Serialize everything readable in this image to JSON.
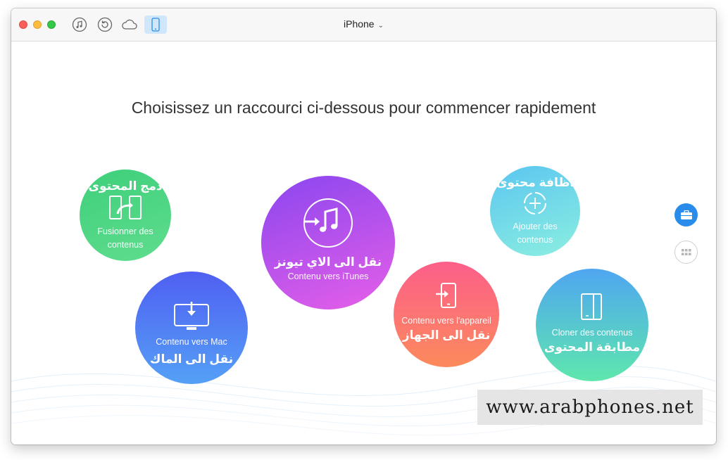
{
  "window": {
    "device_title": "iPhone",
    "toolbar_icons": [
      "music-note-icon",
      "restore-icon",
      "cloud-icon",
      "phone-icon"
    ]
  },
  "main": {
    "headline": "Choisissez un raccourci ci-dessous pour commencer rapidement"
  },
  "shortcuts": {
    "merge": {
      "ar": "دمج المحتوى",
      "fr": "Fusionner des contenus",
      "icon": "merge-devices-icon"
    },
    "mac": {
      "fr": "Contenu vers Mac",
      "ar": "نقل الى الماك",
      "icon": "monitor-download-icon"
    },
    "itunes": {
      "ar": "نقل الى الاي تيونز",
      "fr": "Contenu vers iTunes",
      "icon": "itunes-icon"
    },
    "device": {
      "fr": "Contenu vers l'appareil",
      "ar": "نقل الى الجهاز",
      "icon": "phone-import-icon"
    },
    "add": {
      "ar": "اظافة محتوى",
      "fr": "Ajouter des contenus",
      "icon": "add-circle-icon"
    },
    "clone": {
      "fr": "Cloner des contenus",
      "ar": "مطابقة المحتوى",
      "icon": "clone-device-icon"
    }
  },
  "sidebar_buttons": [
    "toolbox-icon",
    "grid-icon"
  ],
  "watermark": "www.arabphones.net",
  "colors": {
    "accent": "#2a8cea",
    "merge": "#3ecf7a",
    "mac": "#4f5ff2",
    "itunes": "#8a46ef",
    "device": "#fc5f8a",
    "add": "#5bc6f0",
    "clone": "#4fa6f1"
  }
}
